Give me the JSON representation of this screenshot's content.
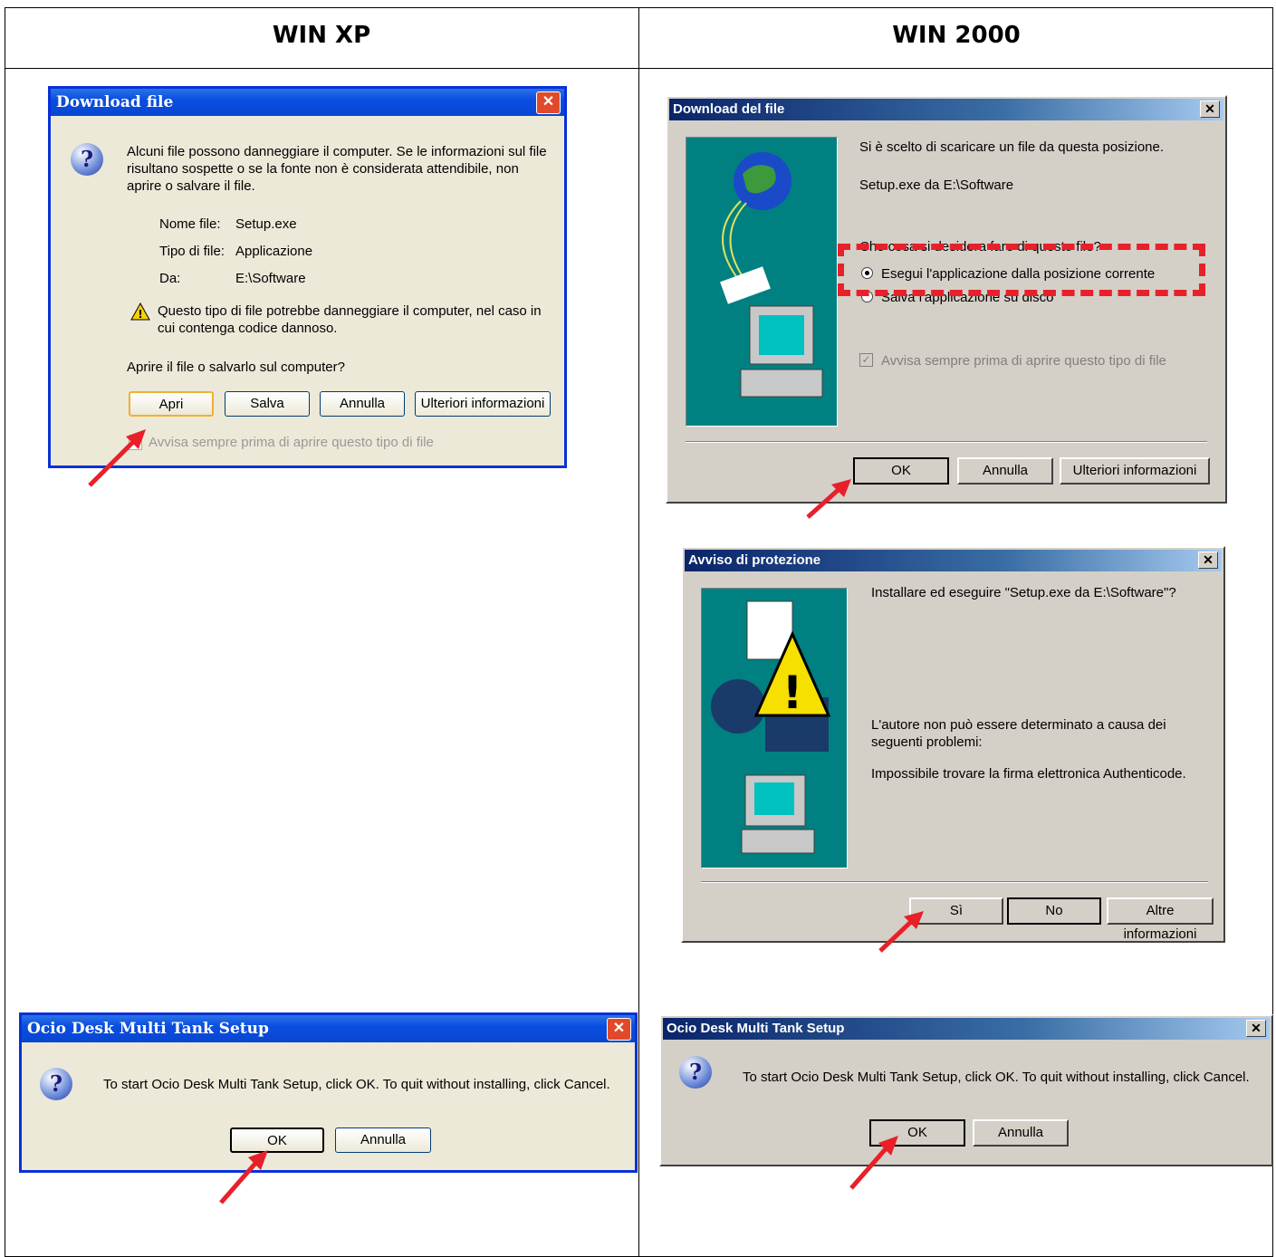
{
  "headers": {
    "left": "WIN XP",
    "right": "WIN 2000"
  },
  "xp_download": {
    "title": "Download file",
    "message": "Alcuni file possono danneggiare il computer. Se le informazioni sul file risultano sospette o se la fonte non è considerata attendibile, non aprire o salvare il file.",
    "name_label": "Nome file:",
    "name_value": "Setup.exe",
    "type_label": "Tipo di file:",
    "type_value": "Applicazione",
    "from_label": "Da:",
    "from_value": "E:\\Software",
    "warning": "Questo tipo di file potrebbe danneggiare il computer, nel caso in cui contenga codice dannoso.",
    "question": "Aprire il file o salvarlo sul computer?",
    "btn_open": "Apri",
    "btn_save": "Salva",
    "btn_cancel": "Annulla",
    "btn_more": "Ulteriori informazioni",
    "checkbox": "Avvisa sempre prima di aprire questo tipo di file"
  },
  "w2k_download": {
    "title": "Download del file",
    "line1": "Si è scelto di scaricare un file da questa posizione.",
    "line2": "Setup.exe da E:\\Software",
    "question": "Che cosa si desidera fare di questo file?",
    "radio1": "Esegui l'applicazione dalla posizione corrente",
    "radio2": "Salva l'applicazione su disco",
    "checkbox": "Avvisa sempre prima di aprire questo tipo di file",
    "btn_ok": "OK",
    "btn_cancel": "Annulla",
    "btn_more": "Ulteriori informazioni"
  },
  "w2k_security": {
    "title": "Avviso di protezione",
    "line1": "Installare ed eseguire \"Setup.exe da E:\\Software\"?",
    "line2": "L'autore non può essere determinato a causa dei seguenti problemi:",
    "line3": "Impossibile trovare la firma elettronica Authenticode.",
    "btn_yes": "Sì",
    "btn_no": "No",
    "btn_more": "Altre informazioni"
  },
  "xp_setup": {
    "title": "Ocio Desk Multi Tank Setup",
    "message": "To start Ocio Desk Multi Tank Setup, click OK. To quit without installing, click Cancel.",
    "btn_ok": "OK",
    "btn_cancel": "Annulla"
  },
  "w2k_setup": {
    "title": "Ocio Desk Multi Tank Setup",
    "message": "To start Ocio Desk Multi Tank Setup, click OK. To quit without installing, click Cancel.",
    "btn_ok": "OK",
    "btn_cancel": "Annulla"
  },
  "colors": {
    "arrow": "#e8202a",
    "highlight": "#e8202a",
    "teal": "#008080"
  }
}
